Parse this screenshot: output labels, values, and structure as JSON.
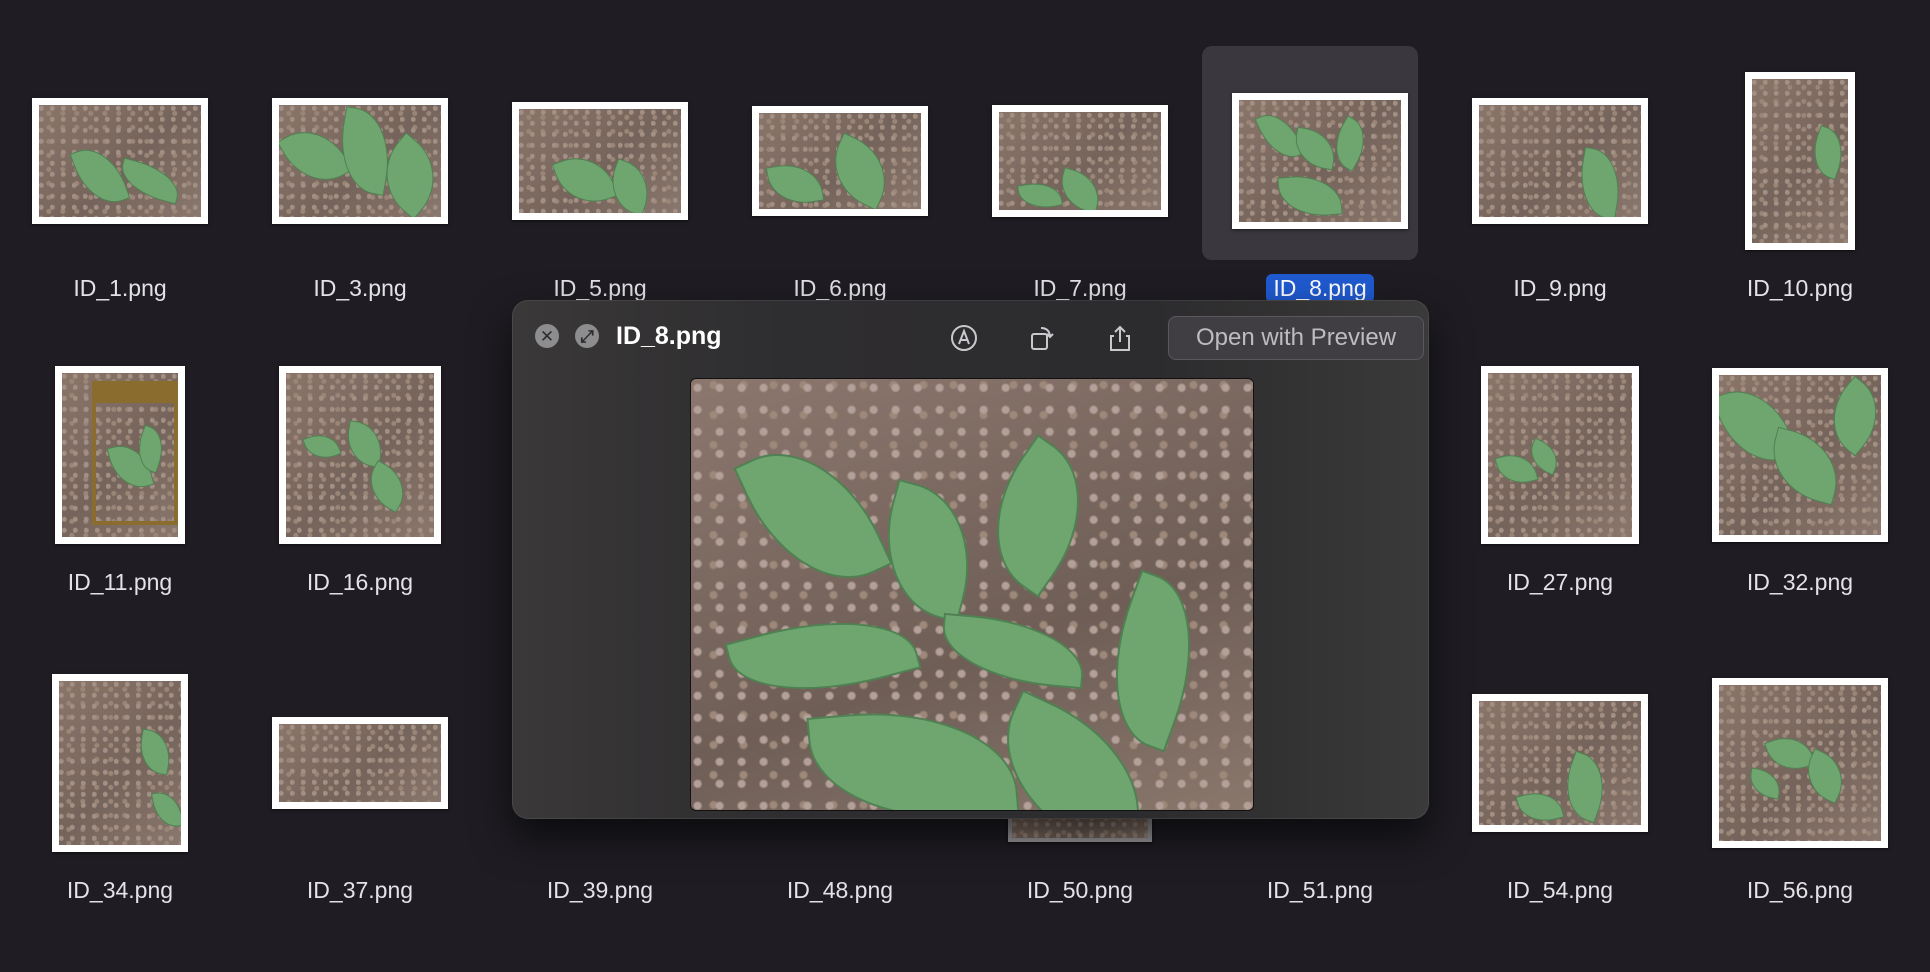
{
  "files": [
    {
      "name": "ID_1.png"
    },
    {
      "name": "ID_3.png"
    },
    {
      "name": "ID_5.png"
    },
    {
      "name": "ID_6.png"
    },
    {
      "name": "ID_7.png"
    },
    {
      "name": "ID_8.png",
      "selected": true
    },
    {
      "name": "ID_9.png"
    },
    {
      "name": "ID_10.png"
    },
    {
      "name": "ID_11.png"
    },
    {
      "name": "ID_16.png"
    },
    {
      "name": "ID_27.png"
    },
    {
      "name": "ID_32.png"
    },
    {
      "name": "ID_34.png"
    },
    {
      "name": "ID_37.png"
    },
    {
      "name": "ID_39.png"
    },
    {
      "name": "ID_48.png"
    },
    {
      "name": "ID_50.png"
    },
    {
      "name": "ID_51.png"
    },
    {
      "name": "ID_54.png"
    },
    {
      "name": "ID_56.png"
    }
  ],
  "quicklook": {
    "title": "ID_8.png",
    "open_with_label": "Open with Preview",
    "close_icon": "close-icon",
    "fullscreen_icon": "fullscreen-icon",
    "markup_icon": "markup-icon",
    "rotate_icon": "rotate-icon",
    "share_icon": "share-icon"
  },
  "colors": {
    "background": "#1f1d23",
    "selection": "#1f5ad0",
    "panel": "#2e2d2f"
  }
}
